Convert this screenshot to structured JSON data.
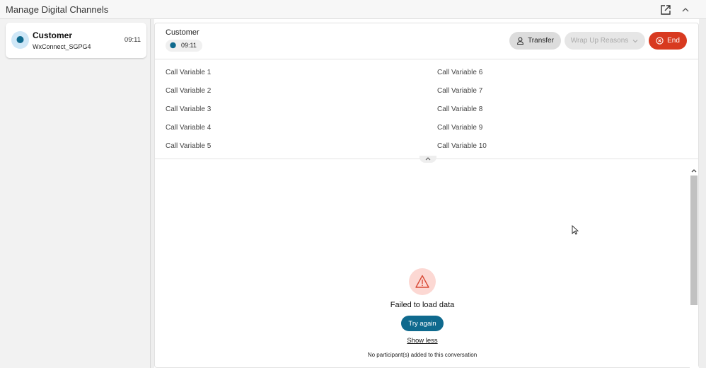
{
  "window": {
    "title": "Manage Digital Channels"
  },
  "task_list": [
    {
      "name": "Customer",
      "queue": "WxConnect_SGPG4",
      "time": "09:11"
    }
  ],
  "header": {
    "customer_name": "Customer",
    "timer": "09:11",
    "transfer_label": "Transfer",
    "wrapup_label": "Wrap Up Reasons",
    "end_label": "End"
  },
  "call_variables": {
    "left": [
      "Call Variable 1",
      "Call Variable 2",
      "Call Variable 3",
      "Call Variable 4",
      "Call Variable 5"
    ],
    "right": [
      "Call Variable 6",
      "Call Variable 7",
      "Call Variable 8",
      "Call Variable 9",
      "Call Variable 10"
    ]
  },
  "error_panel": {
    "message": "Failed to load data",
    "retry_label": "Try again",
    "toggle_label": "Show less",
    "note": "No participant(s) added to this conversation"
  },
  "colors": {
    "accent": "#0f6a8e",
    "end": "#d83a20",
    "warning_bg": "#fcd8d3",
    "warning_icon": "#d84a36",
    "chat_icon": "#0f6a8e"
  }
}
